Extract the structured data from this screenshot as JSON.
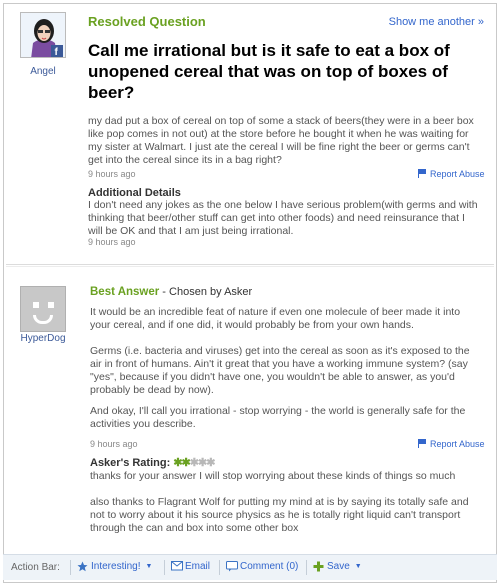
{
  "question": {
    "status": "Resolved Question",
    "show_another": "Show me another »",
    "asker_name": "Angel",
    "title": "Call me irrational but is it safe to eat a box of unopened cereal that was on top of boxes of beer?",
    "body": "my dad put a box of cereal on top of some a stack of beers(they were in a beer box like pop comes in not out) at the store before he bought it when he was waiting for my sister at Walmart. I just ate the cereal I will be fine right the beer or germs can't get into the cereal since its in a bag right?",
    "time": "9 hours ago",
    "report_abuse": "Report Abuse",
    "additional_details_title": "Additional Details",
    "additional_details": "I don't need any jokes as the one below I have serious problem(with germs and with thinking that beer/other stuff can get into other foods) and need reinsurance that I will be OK and that I am just being irrational.",
    "additional_time": "9 hours ago"
  },
  "answer": {
    "answerer_name": "HyperDog",
    "best_answer_label": "Best Answer",
    "chosen_by": " - Chosen by Asker",
    "paragraphs": [
      "It would be an incredible feat of nature if even one molecule of beer made it into your cereal, and if one did, it would probably be from your own hands.",
      "Germs (i.e. bacteria and viruses) get into the cereal as soon as it's exposed to the air in front of humans. Ain't it great that you have a working immune system? (say \"yes\", because if you didn't have one, you wouldn't be able to answer, as you'd probably be dead by now).",
      "And okay, I'll call you irrational - stop worrying - the world is generally safe for the activities you describe."
    ],
    "time": "9 hours ago",
    "report_abuse": "Report Abuse",
    "rating_label": "Asker's Rating:",
    "rating_value": 2,
    "rating_max": 5,
    "rating_comments": [
      "thanks for your answer I will stop worrying about these kinds of things so much",
      "also thanks to Flagrant Wolf for putting my mind at is by saying its totally safe and not to worry about it his source physics as he is totally right liquid can't transport through the can and box into some other box"
    ]
  },
  "action_bar": {
    "label": "Action Bar:",
    "interesting": "Interesting!",
    "email": "Email",
    "comment": "Comment (0)",
    "save": "Save"
  },
  "colors": {
    "accent_green": "#6aa121",
    "link_blue": "#3366cc"
  }
}
